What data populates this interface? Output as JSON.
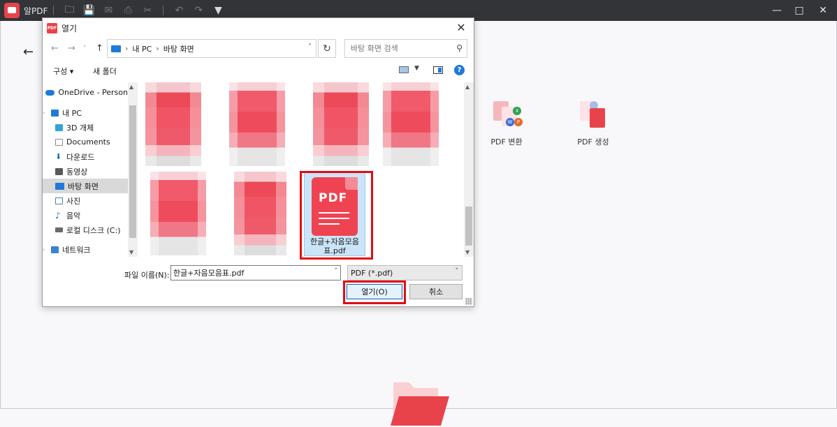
{
  "app": {
    "name": "알PDF",
    "colors": {
      "brand": "#e8434b",
      "titlebar": "#333438",
      "highlight": "#e50914"
    }
  },
  "tools": [
    {
      "label": "PDF 변환",
      "icon": "pdf-convert-icon"
    },
    {
      "label": "PDF 생성",
      "icon": "pdf-create-icon"
    }
  ],
  "dialog": {
    "title": "열기",
    "icon_text": "PDF",
    "address": [
      "내 PC",
      "바탕 화면"
    ],
    "search_placeholder": "바탕 화면 검색",
    "organize_label": "구성 ▾",
    "new_folder_label": "새 폴더",
    "nav_items": [
      {
        "label": "OneDrive - Person",
        "icon": "onedrive-icon",
        "color": "#1f7ad8"
      },
      {
        "label": "내 PC",
        "icon": "pc-icon",
        "color": "#1f7ad8"
      },
      {
        "label": "3D 개체",
        "icon": "3d-objects-icon",
        "color": "#35a3d8"
      },
      {
        "label": "Documents",
        "icon": "documents-icon",
        "color": "#8a8a8a"
      },
      {
        "label": "다운로드",
        "icon": "download-icon",
        "color": "#1f6fc8"
      },
      {
        "label": "동영상",
        "icon": "video-icon",
        "color": "#5a5a5a"
      },
      {
        "label": "바탕 화면",
        "icon": "desktop-icon",
        "color": "#1f7ad8"
      },
      {
        "label": "사진",
        "icon": "pictures-icon",
        "color": "#4a7bb0"
      },
      {
        "label": "음악",
        "icon": "music-icon",
        "color": "#2a6fc0"
      },
      {
        "label": "로컬 디스크 (C:)",
        "icon": "disk-icon",
        "color": "#6a6a6a"
      },
      {
        "label": "네트워크",
        "icon": "network-icon",
        "color": "#3b82d0"
      }
    ],
    "selected_file": {
      "name": "한글+자음모음표.pdf",
      "icon_text": "PDF"
    },
    "filename_label": "파일 이름(N):",
    "filename_value": "한글+자음모음표.pdf",
    "filetype_value": "PDF (*.pdf)",
    "open_label": "열기(O)",
    "cancel_label": "취소"
  }
}
